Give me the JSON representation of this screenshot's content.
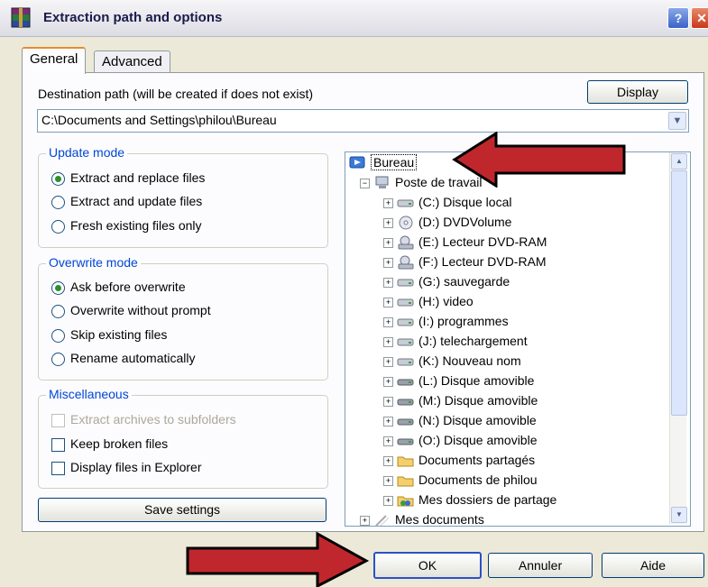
{
  "window": {
    "title": "Extraction path and options",
    "help_glyph": "?",
    "close_glyph": "✕"
  },
  "tabs": [
    {
      "label": "General"
    },
    {
      "label": "Advanced"
    }
  ],
  "destination": {
    "label": "Destination path (will be created if does not exist)",
    "value": "C:\\Documents and Settings\\philou\\Bureau",
    "display_button": "Display"
  },
  "update_mode": {
    "title": "Update mode",
    "options": [
      {
        "label": "Extract and replace files",
        "selected": true
      },
      {
        "label": "Extract and update files",
        "selected": false
      },
      {
        "label": "Fresh existing files only",
        "selected": false
      }
    ]
  },
  "overwrite_mode": {
    "title": "Overwrite mode",
    "options": [
      {
        "label": "Ask before overwrite",
        "selected": true
      },
      {
        "label": "Overwrite without prompt",
        "selected": false
      },
      {
        "label": "Skip existing files",
        "selected": false
      },
      {
        "label": "Rename automatically",
        "selected": false
      }
    ]
  },
  "misc": {
    "title": "Miscellaneous",
    "options": [
      {
        "label": "Extract archives to subfolders",
        "checked": false,
        "disabled": true
      },
      {
        "label": "Keep broken files",
        "checked": false,
        "disabled": false
      },
      {
        "label": "Display files in Explorer",
        "checked": false,
        "disabled": false
      }
    ]
  },
  "save_settings": "Save settings",
  "tree": {
    "root": "Bureau",
    "computer": "Poste de travail",
    "items": [
      {
        "label": "(C:) Disque local",
        "icon": "hard-drive-icon"
      },
      {
        "label": "(D:) DVDVolume",
        "icon": "cd-drive-icon"
      },
      {
        "label": "(E:) Lecteur DVD-RAM",
        "icon": "dvd-ram-icon"
      },
      {
        "label": "(F:) Lecteur DVD-RAM",
        "icon": "dvd-ram-icon"
      },
      {
        "label": "(G:) sauvegarde",
        "icon": "hard-drive-icon"
      },
      {
        "label": "(H:) video",
        "icon": "hard-drive-icon"
      },
      {
        "label": "(I:) programmes",
        "icon": "hard-drive-icon"
      },
      {
        "label": "(J:) telechargement",
        "icon": "hard-drive-icon"
      },
      {
        "label": "(K:) Nouveau nom",
        "icon": "hard-drive-icon"
      },
      {
        "label": "(L:) Disque amovible",
        "icon": "removable-drive-icon"
      },
      {
        "label": "(M:) Disque amovible",
        "icon": "removable-drive-icon"
      },
      {
        "label": "(N:) Disque amovible",
        "icon": "removable-drive-icon"
      },
      {
        "label": "(O:) Disque amovible",
        "icon": "removable-drive-icon"
      },
      {
        "label": "Documents partagés",
        "icon": "folder-icon"
      },
      {
        "label": "Documents de philou",
        "icon": "folder-icon"
      },
      {
        "label": "Mes dossiers de partage",
        "icon": "shared-folder-icon"
      }
    ],
    "my_documents": "Mes documents"
  },
  "buttons": {
    "ok": "OK",
    "cancel": "Annuler",
    "help": "Aide"
  },
  "colors": {
    "arrow_fill": "#c0272d",
    "group_title": "#0046d5",
    "radio_dot": "#2c8f2c"
  }
}
